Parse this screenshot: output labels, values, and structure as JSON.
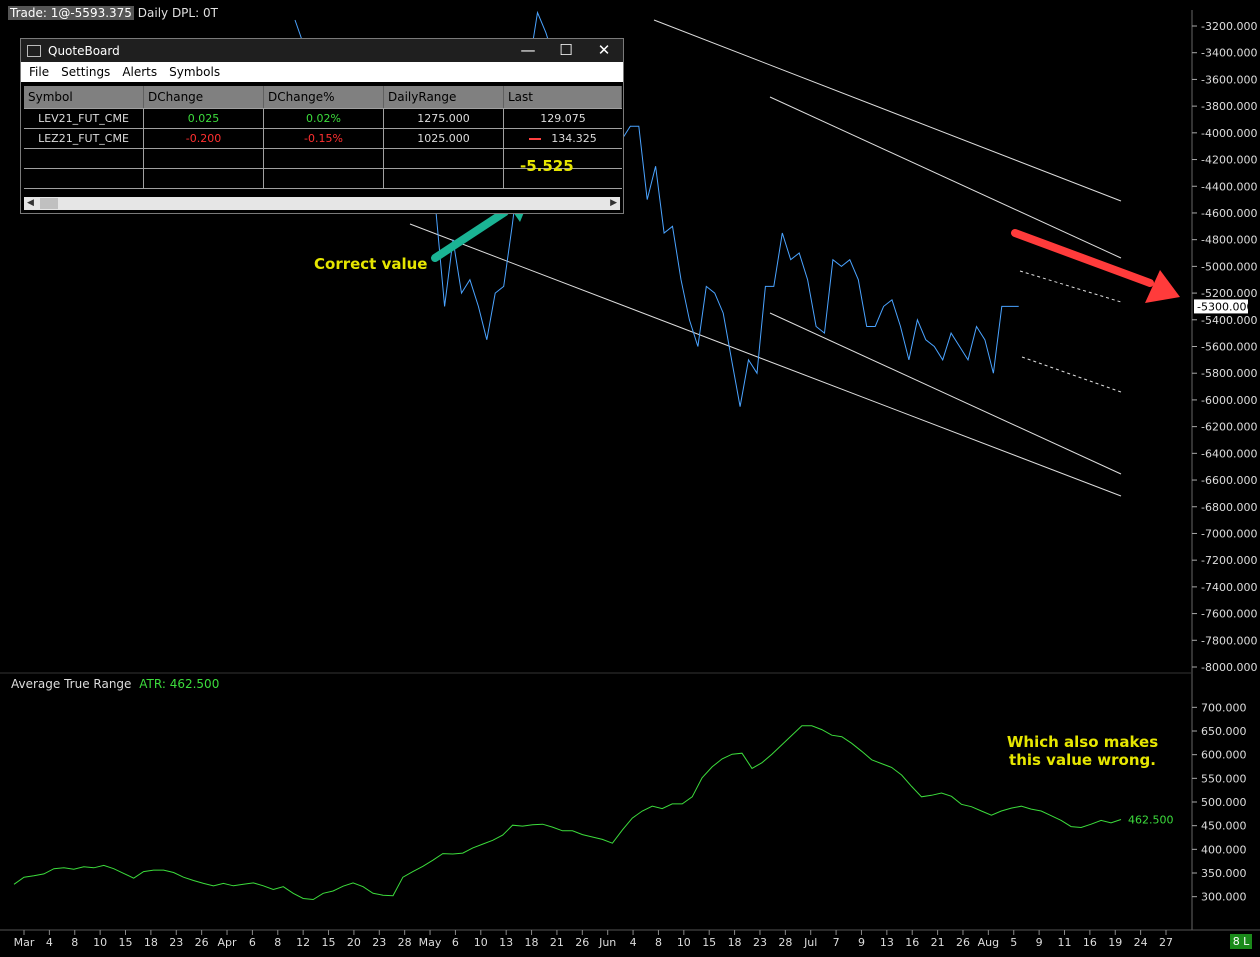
{
  "status": {
    "trade": "Trade: 1@-5593.375",
    "rest": "Daily DPL: 0T"
  },
  "quoteboard": {
    "title": "QuoteBoard",
    "window_controls": [
      "—",
      "☐",
      "✕"
    ],
    "menu": [
      "File",
      "Settings",
      "Alerts",
      "Symbols"
    ],
    "columns": [
      "Symbol",
      "DChange",
      "DChange%",
      "DailyRange",
      "Last"
    ],
    "rows": [
      {
        "symbol": "LEV21_FUT_CME",
        "dchange": "0.025",
        "dchange_pct": "0.02%",
        "daily_range": "1275.000",
        "last": "129.075"
      },
      {
        "symbol": "LEZ21_FUT_CME",
        "dchange": "-0.200",
        "dchange_pct": "-0.15%",
        "daily_range": "1025.000",
        "last": "134.325"
      }
    ]
  },
  "annotations": {
    "computed_value": "-5.525",
    "correct_label": "Correct value",
    "note_line1": "Which also makes",
    "note_line2": "this value wrong."
  },
  "atr": {
    "title": "Average True Range",
    "value_label": "ATR: 462.500"
  },
  "badge": "8 L",
  "colors": {
    "price": "#4aa3ff",
    "atr": "#3cdc3c",
    "arrow_red": "#ff3b3b",
    "arrow_green": "#1ab394"
  },
  "chart_data": [
    {
      "type": "line",
      "name": "price",
      "y_ticks": [
        "-3200.000",
        "-3400.000",
        "-3600.000",
        "-3800.000",
        "-4000.000",
        "-4200.000",
        "-4400.000",
        "-4600.000",
        "-4800.000",
        "-5000.000",
        "-5200.000",
        "-5400.000",
        "-5600.000",
        "-5800.000",
        "-6000.000",
        "-6200.000",
        "-6400.000",
        "-6600.000",
        "-6800.000",
        "-7000.000",
        "-7200.000",
        "-7400.000",
        "-7600.000",
        "-7800.000",
        "-8000.000"
      ],
      "current_label": "-5300.000",
      "ylim": [
        -8000,
        -3200
      ],
      "x": [
        50,
        51,
        52,
        53,
        54,
        55,
        56,
        57,
        58,
        59,
        60,
        61,
        62,
        63,
        64,
        65,
        66,
        67,
        68,
        69,
        70,
        71,
        72,
        73,
        74,
        75,
        76,
        77,
        78,
        79,
        80,
        81,
        82,
        83,
        84,
        85,
        86,
        87,
        88,
        89,
        90,
        91,
        92,
        93,
        94,
        95,
        96,
        97,
        98,
        99,
        100,
        101,
        102,
        103,
        104,
        105,
        106,
        107,
        108,
        109,
        110,
        111,
        112,
        113,
        114,
        115,
        116,
        117,
        118,
        119,
        120,
        121,
        122,
        123,
        124,
        125,
        126,
        127,
        128,
        129,
        130,
        131
      ],
      "values": [
        -4600,
        -5300,
        -4800,
        -5200,
        -5100,
        -5300,
        -5550,
        -5200,
        -5150,
        -4700,
        -4200,
        -3500,
        -3100,
        -3250,
        -3450,
        -3550,
        -3650,
        -4000,
        -3300,
        -3400,
        -3950,
        -4400,
        -4050,
        -3950,
        -3950,
        -4500,
        -4250,
        -4750,
        -4700,
        -5100,
        -5400,
        -5600,
        -5150,
        -5200,
        -5350,
        -5700,
        -6050,
        -5700,
        -5800,
        -5150,
        -5150,
        -4750,
        -4950,
        -4900,
        -5100,
        -5450,
        -5500,
        -4950,
        -5000,
        -4950,
        -5100,
        -5450,
        -5450,
        -5300,
        -5250,
        -5450,
        -5700,
        -5400,
        -5550,
        -5600,
        -5700,
        -5500,
        -5600,
        -5700,
        -5450,
        -5550,
        -5800,
        -5300,
        -5300,
        -5300,
        -5300,
        -5300,
        -5300,
        -5300,
        -5300,
        -5300,
        -5300,
        -5300,
        -5300,
        -5300,
        -5300,
        -5300
      ]
    },
    {
      "type": "line",
      "name": "atr",
      "y_ticks": [
        "700.000",
        "650.000",
        "600.000",
        "550.000",
        "500.000",
        "450.000",
        "400.000",
        "350.000",
        "300.000"
      ],
      "ylim": [
        275,
        725
      ],
      "current": 462.5,
      "x_ticks": [
        "Mar",
        "4",
        "8",
        "10",
        "15",
        "18",
        "23",
        "26",
        "Apr",
        "6",
        "8",
        "12",
        "15",
        "20",
        "23",
        "28",
        "May",
        "6",
        "10",
        "13",
        "18",
        "21",
        "26",
        "Jun",
        "4",
        "8",
        "10",
        "15",
        "18",
        "23",
        "28",
        "Jul",
        "7",
        "9",
        "13",
        "16",
        "21",
        "26",
        "Aug",
        "5",
        "9",
        "11",
        "16",
        "19",
        "24",
        "27"
      ],
      "values": [
        325,
        340,
        343,
        347,
        358,
        360,
        357,
        362,
        360,
        365,
        358,
        348,
        338,
        352,
        355,
        355,
        350,
        340,
        333,
        327,
        322,
        327,
        322,
        325,
        328,
        322,
        314,
        320,
        306,
        295,
        293,
        306,
        311,
        321,
        328,
        320,
        306,
        302,
        301,
        340,
        352,
        363,
        376,
        390,
        389,
        391,
        402,
        410,
        418,
        429,
        450,
        448,
        451,
        452,
        446,
        438,
        438,
        430,
        425,
        420,
        412,
        440,
        465,
        480,
        490,
        485,
        495,
        495,
        510,
        550,
        573,
        590,
        600,
        602,
        570,
        582,
        600,
        620,
        640,
        660,
        660,
        652,
        640,
        637,
        623,
        606,
        588,
        580,
        572,
        556,
        532,
        510,
        513,
        518,
        511,
        494,
        489,
        480,
        471,
        480,
        486,
        490,
        484,
        480,
        470,
        460,
        447,
        445,
        452,
        460,
        455,
        462
      ]
    }
  ]
}
